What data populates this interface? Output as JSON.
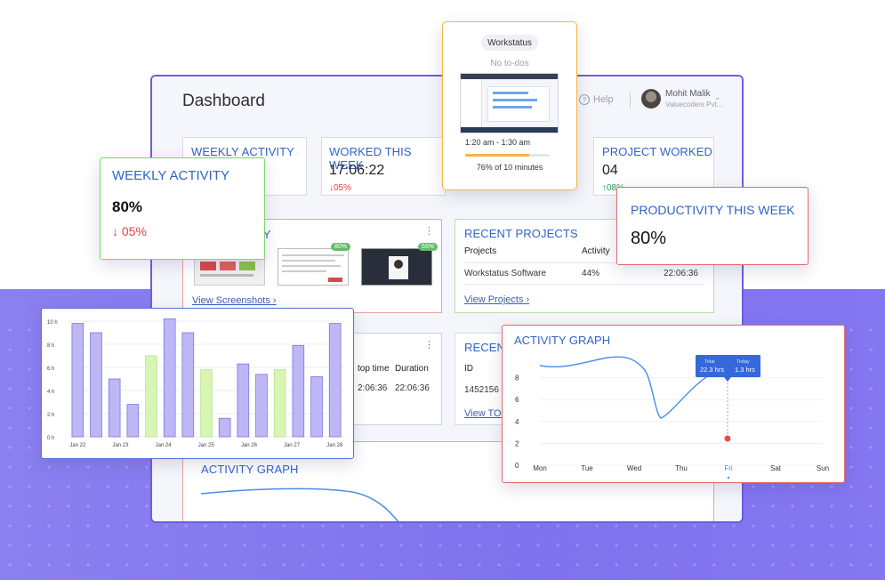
{
  "dashboard": {
    "title": "Dashboard",
    "help_label": "Help",
    "user": {
      "name": "Mohit Malik",
      "org": "Valuecoders Pvt..."
    }
  },
  "bg_cards": {
    "weekly_activity_title": "WEEKLY ACTIVITY",
    "worked_title": "WORKED THIS WEEK",
    "worked_value": "17:06:22",
    "worked_delta": "↓05%",
    "project_title": "PROJECT WORKED",
    "project_value": "04",
    "project_delta": "↑08%",
    "screenshots_title": "ITY",
    "screenshot_badges": [
      "80%",
      "55%"
    ],
    "view_screenshots": "View Screenshots",
    "recent_projects": {
      "title": "RECENT PROJECTS",
      "col_project": "Projects",
      "col_activity": "Activity",
      "row_name": "Workstatus Software",
      "row_activity": "44%",
      "row_time": "22:06:36",
      "link": "View Projects"
    },
    "timesheet": {
      "col_stop": "top time",
      "col_duration": "Duration",
      "stop_value": "2:06:36",
      "duration_value": "22:06:36"
    },
    "recent_todos": {
      "title": "RECENT",
      "col_id": "ID",
      "row_id": "1452156",
      "link": "View TO-"
    },
    "activity_graph_title": "ACTIVITY GRAPH"
  },
  "weekly_card": {
    "title": "WEEKLY ACTIVITY",
    "value": "80%",
    "delta": "↓ 05%"
  },
  "productivity_card": {
    "title": "PRODUCTIVITY THIS WEEK",
    "value": "80%"
  },
  "workstatus_card": {
    "pill": "Workstatus",
    "empty": "No to-dos",
    "time_range": "1:20 am - 1:30 am",
    "progress_fraction": 0.76,
    "progress_label": "76% of 10 minutes"
  },
  "chart_data": [
    {
      "type": "bar",
      "categories": [
        "Jan 22",
        "",
        "Jan 23",
        "",
        "Jan 24",
        "",
        "Jan 25",
        "",
        "Jan 26",
        "",
        "Jan 27",
        "",
        "Jan 28"
      ],
      "values": [
        9.8,
        9.0,
        5.0,
        2.8,
        7.0,
        10.2,
        9.0,
        5.8,
        1.6,
        6.3,
        5.4,
        5.8,
        7.9,
        5.2,
        9.8
      ],
      "bar_colors": [
        "purple",
        "purple",
        "purple",
        "purple",
        "green",
        "purple",
        "purple",
        "green",
        "purple",
        "purple",
        "purple",
        "green",
        "purple",
        "purple",
        "purple"
      ],
      "y_ticks": [
        "0 h",
        "2 h",
        "4 h",
        "6 h",
        "8 h",
        "10 h"
      ],
      "x_labels": [
        "Jan 22",
        "Jan 23",
        "Jan 24",
        "Jan 25",
        "Jan 26",
        "Jan 27",
        "Jan 28"
      ],
      "ylim": [
        0,
        10
      ]
    },
    {
      "type": "line",
      "title": "ACTIVITY GRAPH",
      "x": [
        "Mon",
        "Tue",
        "Wed",
        "Thu",
        "Fri",
        "Sat",
        "Sun"
      ],
      "y_ticks": [
        "0",
        "2",
        "4",
        "6",
        "8"
      ],
      "ylim": [
        0,
        10
      ],
      "tooltip": {
        "total_label": "Total",
        "total_value": "22.3 hrs",
        "today_label": "Today",
        "today_value": "1.3 hrs"
      },
      "highlight_x": "Fri"
    }
  ],
  "colors": {
    "accent_purple": "#6c5fe0",
    "title_blue": "#2f64c9",
    "bar_purple": "#bdb8f5",
    "bar_green": "#d8f5b4",
    "down_red": "#e0433c",
    "up_green": "#2ea05a",
    "progress_orange": "#f2b640"
  }
}
